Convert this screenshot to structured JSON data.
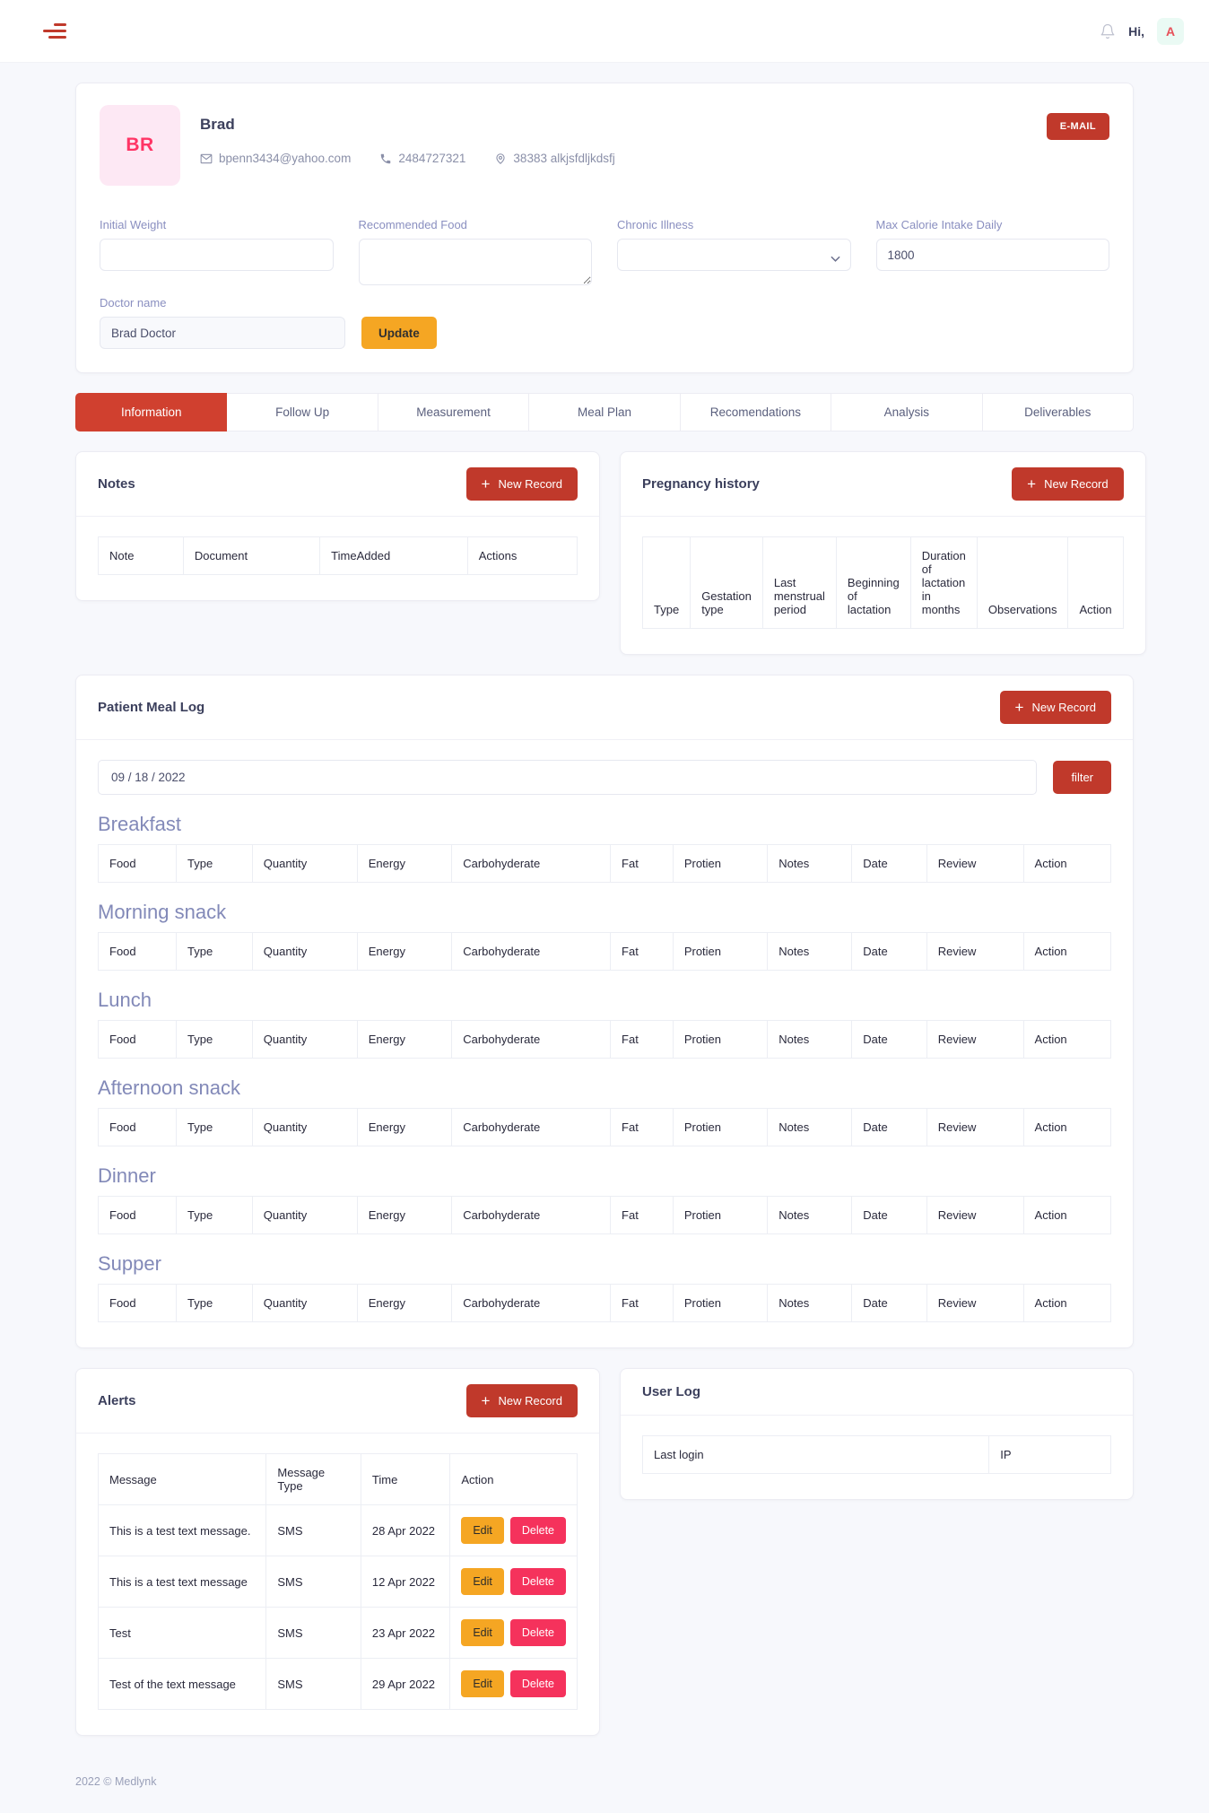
{
  "header": {
    "menu_icon": "hamburger-icon",
    "bell_icon": "notification-bell-icon",
    "greeting": "Hi,",
    "avatar_initial": "A",
    "avatar_bg": "#eafaf4",
    "avatar_color": "#e7515a"
  },
  "profile": {
    "initials": "BR",
    "initials_bg": "#fde8f4",
    "initials_color": "#ff3465",
    "name": "Brad",
    "email": "bpenn3434@yahoo.com",
    "phone": "2484727321",
    "address": "38383 alkjsfdljkdsfj",
    "email_button": "E-MAIL",
    "email_button_color": "#c0392b"
  },
  "form": {
    "initial_weight": {
      "label": "Initial Weight",
      "value": ""
    },
    "recommended_food": {
      "label": "Recommended Food",
      "value": ""
    },
    "chronic_illness": {
      "label": "Chronic Illness",
      "value": ""
    },
    "max_calorie": {
      "label": "Max Calorie Intake Daily",
      "value": "1800"
    },
    "doctor_name": {
      "label": "Doctor name",
      "value": "Brad Doctor"
    },
    "update_button": "Update",
    "update_button_color": "#f5a623"
  },
  "tabs": [
    {
      "label": "Information",
      "active": true
    },
    {
      "label": "Follow Up",
      "active": false
    },
    {
      "label": "Measurement",
      "active": false
    },
    {
      "label": "Meal Plan",
      "active": false
    },
    {
      "label": "Recomendations",
      "active": false
    },
    {
      "label": "Analysis",
      "active": false
    },
    {
      "label": "Deliverables",
      "active": false
    }
  ],
  "notes": {
    "title": "Notes",
    "new_record": "New Record",
    "columns": [
      "Note",
      "Document",
      "TimeAdded",
      "Actions"
    ],
    "rows": []
  },
  "pregnancy_history": {
    "title": "Pregnancy history",
    "new_record": "New Record",
    "columns": [
      "Type",
      "Gestation type",
      "Last menstrual period",
      "Beginning of lactation",
      "Duration of lactation in months",
      "Observations",
      "Action"
    ],
    "rows": []
  },
  "meal_log": {
    "title": "Patient Meal Log",
    "new_record": "New Record",
    "date_value": "09 / 18 / 2022",
    "filter_button": "filter",
    "columns": [
      "Food",
      "Type",
      "Quantity",
      "Energy",
      "Carbohyderate",
      "Fat",
      "Protien",
      "Notes",
      "Date",
      "Review",
      "Action"
    ],
    "sections": [
      {
        "name": "Breakfast",
        "rows": []
      },
      {
        "name": "Morning snack",
        "rows": []
      },
      {
        "name": "Lunch",
        "rows": []
      },
      {
        "name": "Afternoon snack",
        "rows": []
      },
      {
        "name": "Dinner",
        "rows": []
      },
      {
        "name": "Supper",
        "rows": []
      }
    ]
  },
  "alerts": {
    "title": "Alerts",
    "new_record": "New Record",
    "columns": [
      "Message",
      "Message Type",
      "Time",
      "Action"
    ],
    "edit_label": "Edit",
    "delete_label": "Delete",
    "rows": [
      {
        "message": "This is a test text message.",
        "type": "SMS",
        "time": "28 Apr 2022"
      },
      {
        "message": "This is a test text message",
        "type": "SMS",
        "time": "12 Apr 2022"
      },
      {
        "message": "Test",
        "type": "SMS",
        "time": "23 Apr 2022"
      },
      {
        "message": "Test of the text message",
        "type": "SMS",
        "time": "29 Apr 2022"
      }
    ]
  },
  "user_log": {
    "title": "User Log",
    "columns": [
      "Last login",
      "IP"
    ],
    "rows": []
  },
  "footer": {
    "text": "2022  © Medlynk"
  }
}
